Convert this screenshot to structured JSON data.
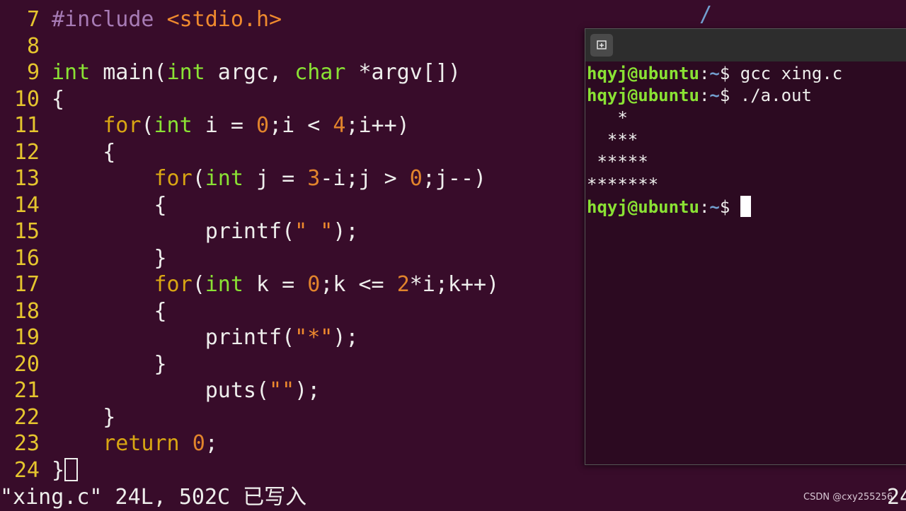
{
  "editor": {
    "top_fragment": "/",
    "lines": [
      {
        "num": "7",
        "parts": [
          {
            "t": "#include ",
            "c": "pre"
          },
          {
            "t": "<stdio.h>",
            "c": "str"
          }
        ]
      },
      {
        "num": "8",
        "parts": []
      },
      {
        "num": "9",
        "parts": [
          {
            "t": "int",
            "c": "type"
          },
          {
            "t": " main(",
            "c": "text"
          },
          {
            "t": "int",
            "c": "type"
          },
          {
            "t": " argc, ",
            "c": "text"
          },
          {
            "t": "char",
            "c": "type"
          },
          {
            "t": " *argv[])",
            "c": "text"
          }
        ]
      },
      {
        "num": "10",
        "parts": [
          {
            "t": "{",
            "c": "text"
          }
        ]
      },
      {
        "num": "11",
        "parts": [
          {
            "t": "    ",
            "c": "text"
          },
          {
            "t": "for",
            "c": "kw"
          },
          {
            "t": "(",
            "c": "text"
          },
          {
            "t": "int",
            "c": "type"
          },
          {
            "t": " i = ",
            "c": "text"
          },
          {
            "t": "0",
            "c": "num"
          },
          {
            "t": ";i < ",
            "c": "text"
          },
          {
            "t": "4",
            "c": "num"
          },
          {
            "t": ";i++)",
            "c": "text"
          }
        ]
      },
      {
        "num": "12",
        "parts": [
          {
            "t": "    {",
            "c": "text"
          }
        ]
      },
      {
        "num": "13",
        "parts": [
          {
            "t": "        ",
            "c": "text"
          },
          {
            "t": "for",
            "c": "kw"
          },
          {
            "t": "(",
            "c": "text"
          },
          {
            "t": "int",
            "c": "type"
          },
          {
            "t": " j = ",
            "c": "text"
          },
          {
            "t": "3",
            "c": "num"
          },
          {
            "t": "-i;j > ",
            "c": "text"
          },
          {
            "t": "0",
            "c": "num"
          },
          {
            "t": ";j--)",
            "c": "text"
          }
        ]
      },
      {
        "num": "14",
        "parts": [
          {
            "t": "        {",
            "c": "text"
          }
        ]
      },
      {
        "num": "15",
        "parts": [
          {
            "t": "            printf(",
            "c": "text"
          },
          {
            "t": "\" \"",
            "c": "str"
          },
          {
            "t": ");",
            "c": "text"
          }
        ]
      },
      {
        "num": "16",
        "parts": [
          {
            "t": "        }",
            "c": "text"
          }
        ]
      },
      {
        "num": "17",
        "parts": [
          {
            "t": "        ",
            "c": "text"
          },
          {
            "t": "for",
            "c": "kw"
          },
          {
            "t": "(",
            "c": "text"
          },
          {
            "t": "int",
            "c": "type"
          },
          {
            "t": " k = ",
            "c": "text"
          },
          {
            "t": "0",
            "c": "num"
          },
          {
            "t": ";k <= ",
            "c": "text"
          },
          {
            "t": "2",
            "c": "num"
          },
          {
            "t": "*i;k++)",
            "c": "text"
          }
        ]
      },
      {
        "num": "18",
        "parts": [
          {
            "t": "        {",
            "c": "text"
          }
        ]
      },
      {
        "num": "19",
        "parts": [
          {
            "t": "            printf(",
            "c": "text"
          },
          {
            "t": "\"*\"",
            "c": "str"
          },
          {
            "t": ");",
            "c": "text"
          }
        ]
      },
      {
        "num": "20",
        "parts": [
          {
            "t": "        }",
            "c": "text"
          }
        ]
      },
      {
        "num": "21",
        "parts": [
          {
            "t": "            puts(",
            "c": "text"
          },
          {
            "t": "\"\"",
            "c": "str"
          },
          {
            "t": ");",
            "c": "text"
          }
        ]
      },
      {
        "num": "22",
        "parts": [
          {
            "t": "    }",
            "c": "text"
          }
        ]
      },
      {
        "num": "23",
        "parts": [
          {
            "t": "    ",
            "c": "text"
          },
          {
            "t": "return",
            "c": "kw"
          },
          {
            "t": " ",
            "c": "text"
          },
          {
            "t": "0",
            "c": "num"
          },
          {
            "t": ";",
            "c": "text"
          }
        ]
      },
      {
        "num": "24",
        "parts": [
          {
            "t": "}",
            "c": "text"
          }
        ],
        "cursor": true
      }
    ],
    "status_message": "\"xing.c\" 24L, 502C 已写入",
    "status_right": "24"
  },
  "terminal": {
    "new_tab_icon": "new-tab-icon",
    "prompt": {
      "user": "hqyj@ubuntu",
      "colon": ":",
      "path": "~",
      "dollar": "$ "
    },
    "lines": [
      {
        "type": "cmd",
        "text": "gcc xing.c"
      },
      {
        "type": "cmd",
        "text": "./a.out"
      },
      {
        "type": "out",
        "text": "   *"
      },
      {
        "type": "out",
        "text": "  ***"
      },
      {
        "type": "out",
        "text": " *****"
      },
      {
        "type": "out",
        "text": "*******"
      },
      {
        "type": "cmd",
        "text": "",
        "cursor": true
      }
    ]
  },
  "watermark": "CSDN @cxy255256",
  "colors": {
    "background": "#380c2a",
    "line_number": "#e5c52e",
    "type": "#8ae234",
    "keyword": "#d9a613",
    "number": "#e1842c",
    "string": "#ef8a2e",
    "preproc": "#a77bb5",
    "prompt_user": "#8ae234",
    "prompt_path": "#729fcf"
  }
}
